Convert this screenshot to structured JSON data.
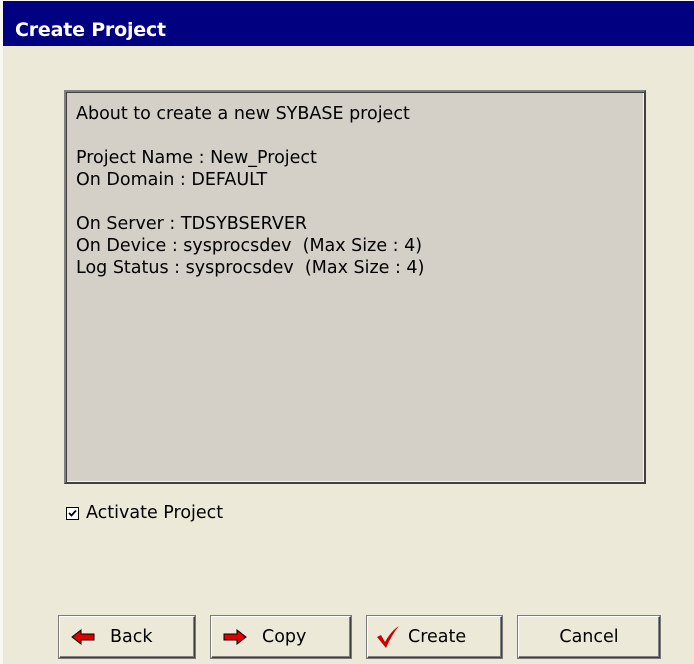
{
  "window": {
    "title": "Create Project"
  },
  "summary": {
    "lines": [
      "About to create a new SYBASE project",
      "",
      "Project Name : New_Project",
      "On Domain : DEFAULT",
      "",
      "On Server : TDSYBSERVER",
      "On Device : sysprocsdev  (Max Size : 4)",
      "Log Status : sysprocsdev  (Max Size : 4)"
    ]
  },
  "options": {
    "activate_label": "Activate Project",
    "activate_checked": true
  },
  "buttons": {
    "back_label": "Back",
    "back_icon": "left-arrow-icon",
    "copy_label": "Copy",
    "copy_icon": "right-arrow-icon",
    "create_label": "Create",
    "create_icon": "checkmark-icon",
    "cancel_label": "Cancel"
  },
  "colors": {
    "titlebar": "#000080",
    "background": "#ece9d8",
    "panel": "#d4d0c8",
    "arrow_red": "#e00000",
    "check_red": "#cc0000"
  }
}
